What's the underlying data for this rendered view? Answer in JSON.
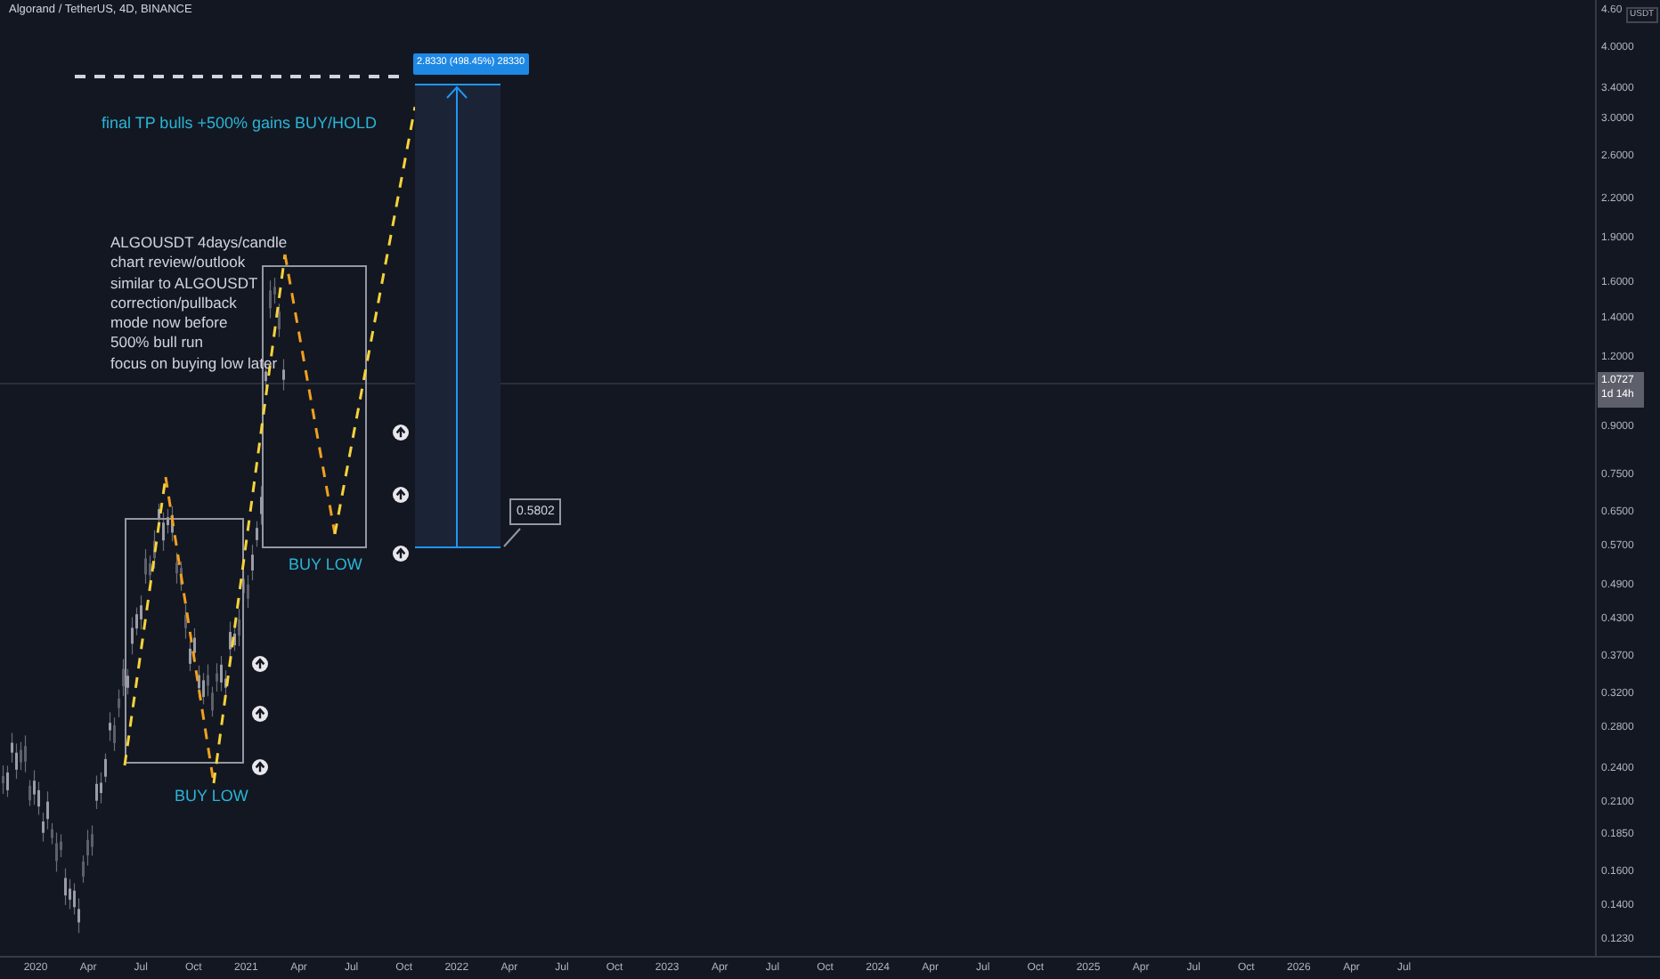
{
  "chart": {
    "title": "Algorand / TetherUS, 4D, BINANCE",
    "currency": "USDT",
    "price_axis": [
      "4.60",
      "4.0000",
      "3.4000",
      "3.0000",
      "2.6000",
      "2.2000",
      "1.9000",
      "1.6000",
      "1.4000",
      "1.2000",
      "0.9000",
      "0.7500",
      "0.6500",
      "0.5700",
      "0.4900",
      "0.4300",
      "0.3700",
      "0.3200",
      "0.2800",
      "0.2400",
      "0.2100",
      "0.1850",
      "0.1600",
      "0.1400",
      "0.1230"
    ],
    "current_price": {
      "price": "1.0727",
      "countdown": "1d 14h"
    },
    "time_axis": [
      "2020",
      "Apr",
      "Jul",
      "Oct",
      "2021",
      "Apr",
      "Jul",
      "Oct",
      "2022",
      "Apr",
      "Jul",
      "Oct",
      "2023",
      "Apr",
      "Jul",
      "Oct",
      "2024",
      "Apr",
      "Jul",
      "Oct",
      "2025",
      "Apr",
      "Jul",
      "Oct",
      "2026",
      "Apr",
      "Jul"
    ],
    "target_label": "2.8330 (498.45%) 28330",
    "target_caption": "final TP bulls +500% gains BUY/HOLD",
    "note_lines": [
      "ALGOUSDT 4days/candle",
      "chart review/outlook",
      "similar to ALGOUSDT",
      "correction/pullback",
      "mode now before",
      "500% bull run",
      "focus on buying low later"
    ],
    "zone_labels": [
      "BUY LOW",
      "BUY LOW"
    ],
    "price_callout": "0.5802"
  }
}
